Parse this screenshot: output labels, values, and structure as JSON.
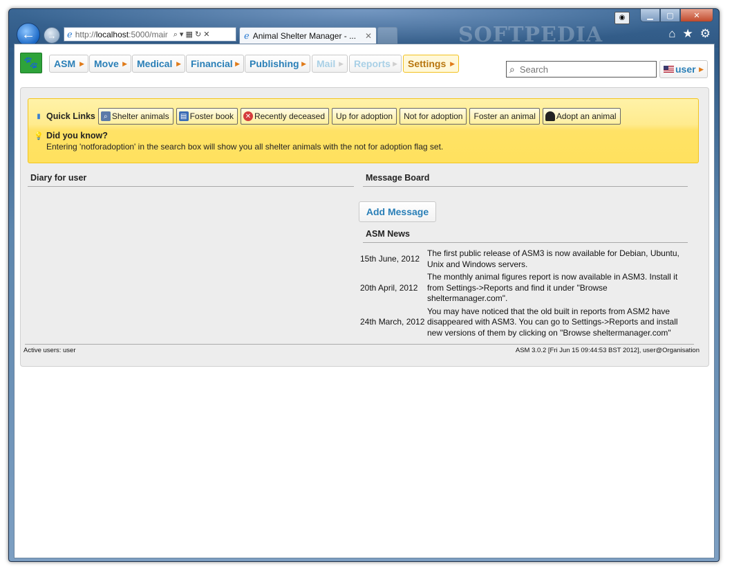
{
  "browser": {
    "url_prefix": "http://",
    "url_host": "localhost",
    "url_rest": ":5000/mair",
    "tab_title": "Animal Shelter Manager - ...",
    "watermark": "SOFTPEDIA"
  },
  "menu": {
    "items": [
      {
        "label": "ASM"
      },
      {
        "label": "Move"
      },
      {
        "label": "Medical"
      },
      {
        "label": "Financial"
      },
      {
        "label": "Publishing"
      },
      {
        "label": "Mail"
      },
      {
        "label": "Reports"
      },
      {
        "label": "Settings"
      }
    ],
    "search_placeholder": "Search",
    "user_label": "user"
  },
  "quicklinks": {
    "title": "Quick Links",
    "buttons": [
      {
        "label": "Shelter animals"
      },
      {
        "label": "Foster book"
      },
      {
        "label": "Recently deceased"
      },
      {
        "label": "Up for adoption"
      },
      {
        "label": "Not for adoption"
      },
      {
        "label": "Foster an animal"
      },
      {
        "label": "Adopt an animal"
      }
    ],
    "did_you_know_title": "Did you know?",
    "did_you_know_text": "Entering 'notforadoption' in the search box will show you all shelter animals with the not for adoption flag set."
  },
  "diary": {
    "title": "Diary for user"
  },
  "message_board": {
    "title": "Message Board",
    "add_label": "Add Message"
  },
  "news": {
    "title": "ASM News",
    "items": [
      {
        "date": "15th June, 2012",
        "text": "The first public release of ASM3 is now available for Debian, Ubuntu, Unix and Windows servers."
      },
      {
        "date": "20th April, 2012",
        "text": "The monthly animal figures report is now available in ASM3. Install it from Settings->Reports and find it under \"Browse sheltermanager.com\"."
      },
      {
        "date": "24th March, 2012",
        "text": "You may have noticed that the old built in reports from ASM2 have disappeared with ASM3. You can go to Settings->Reports and install new versions of them by clicking on \"Browse sheltermanager.com\""
      }
    ]
  },
  "footer": {
    "active_users": "Active users: user",
    "version": "ASM 3.0.2 [Fri Jun 15 09:44:53 BST 2012], user@Organisation"
  },
  "colors": {
    "accent": "#2a7fb7",
    "menu_arrow": "#e07b1a",
    "quicklinks_bg": "#ffe266",
    "logo": "#2ea33a"
  }
}
